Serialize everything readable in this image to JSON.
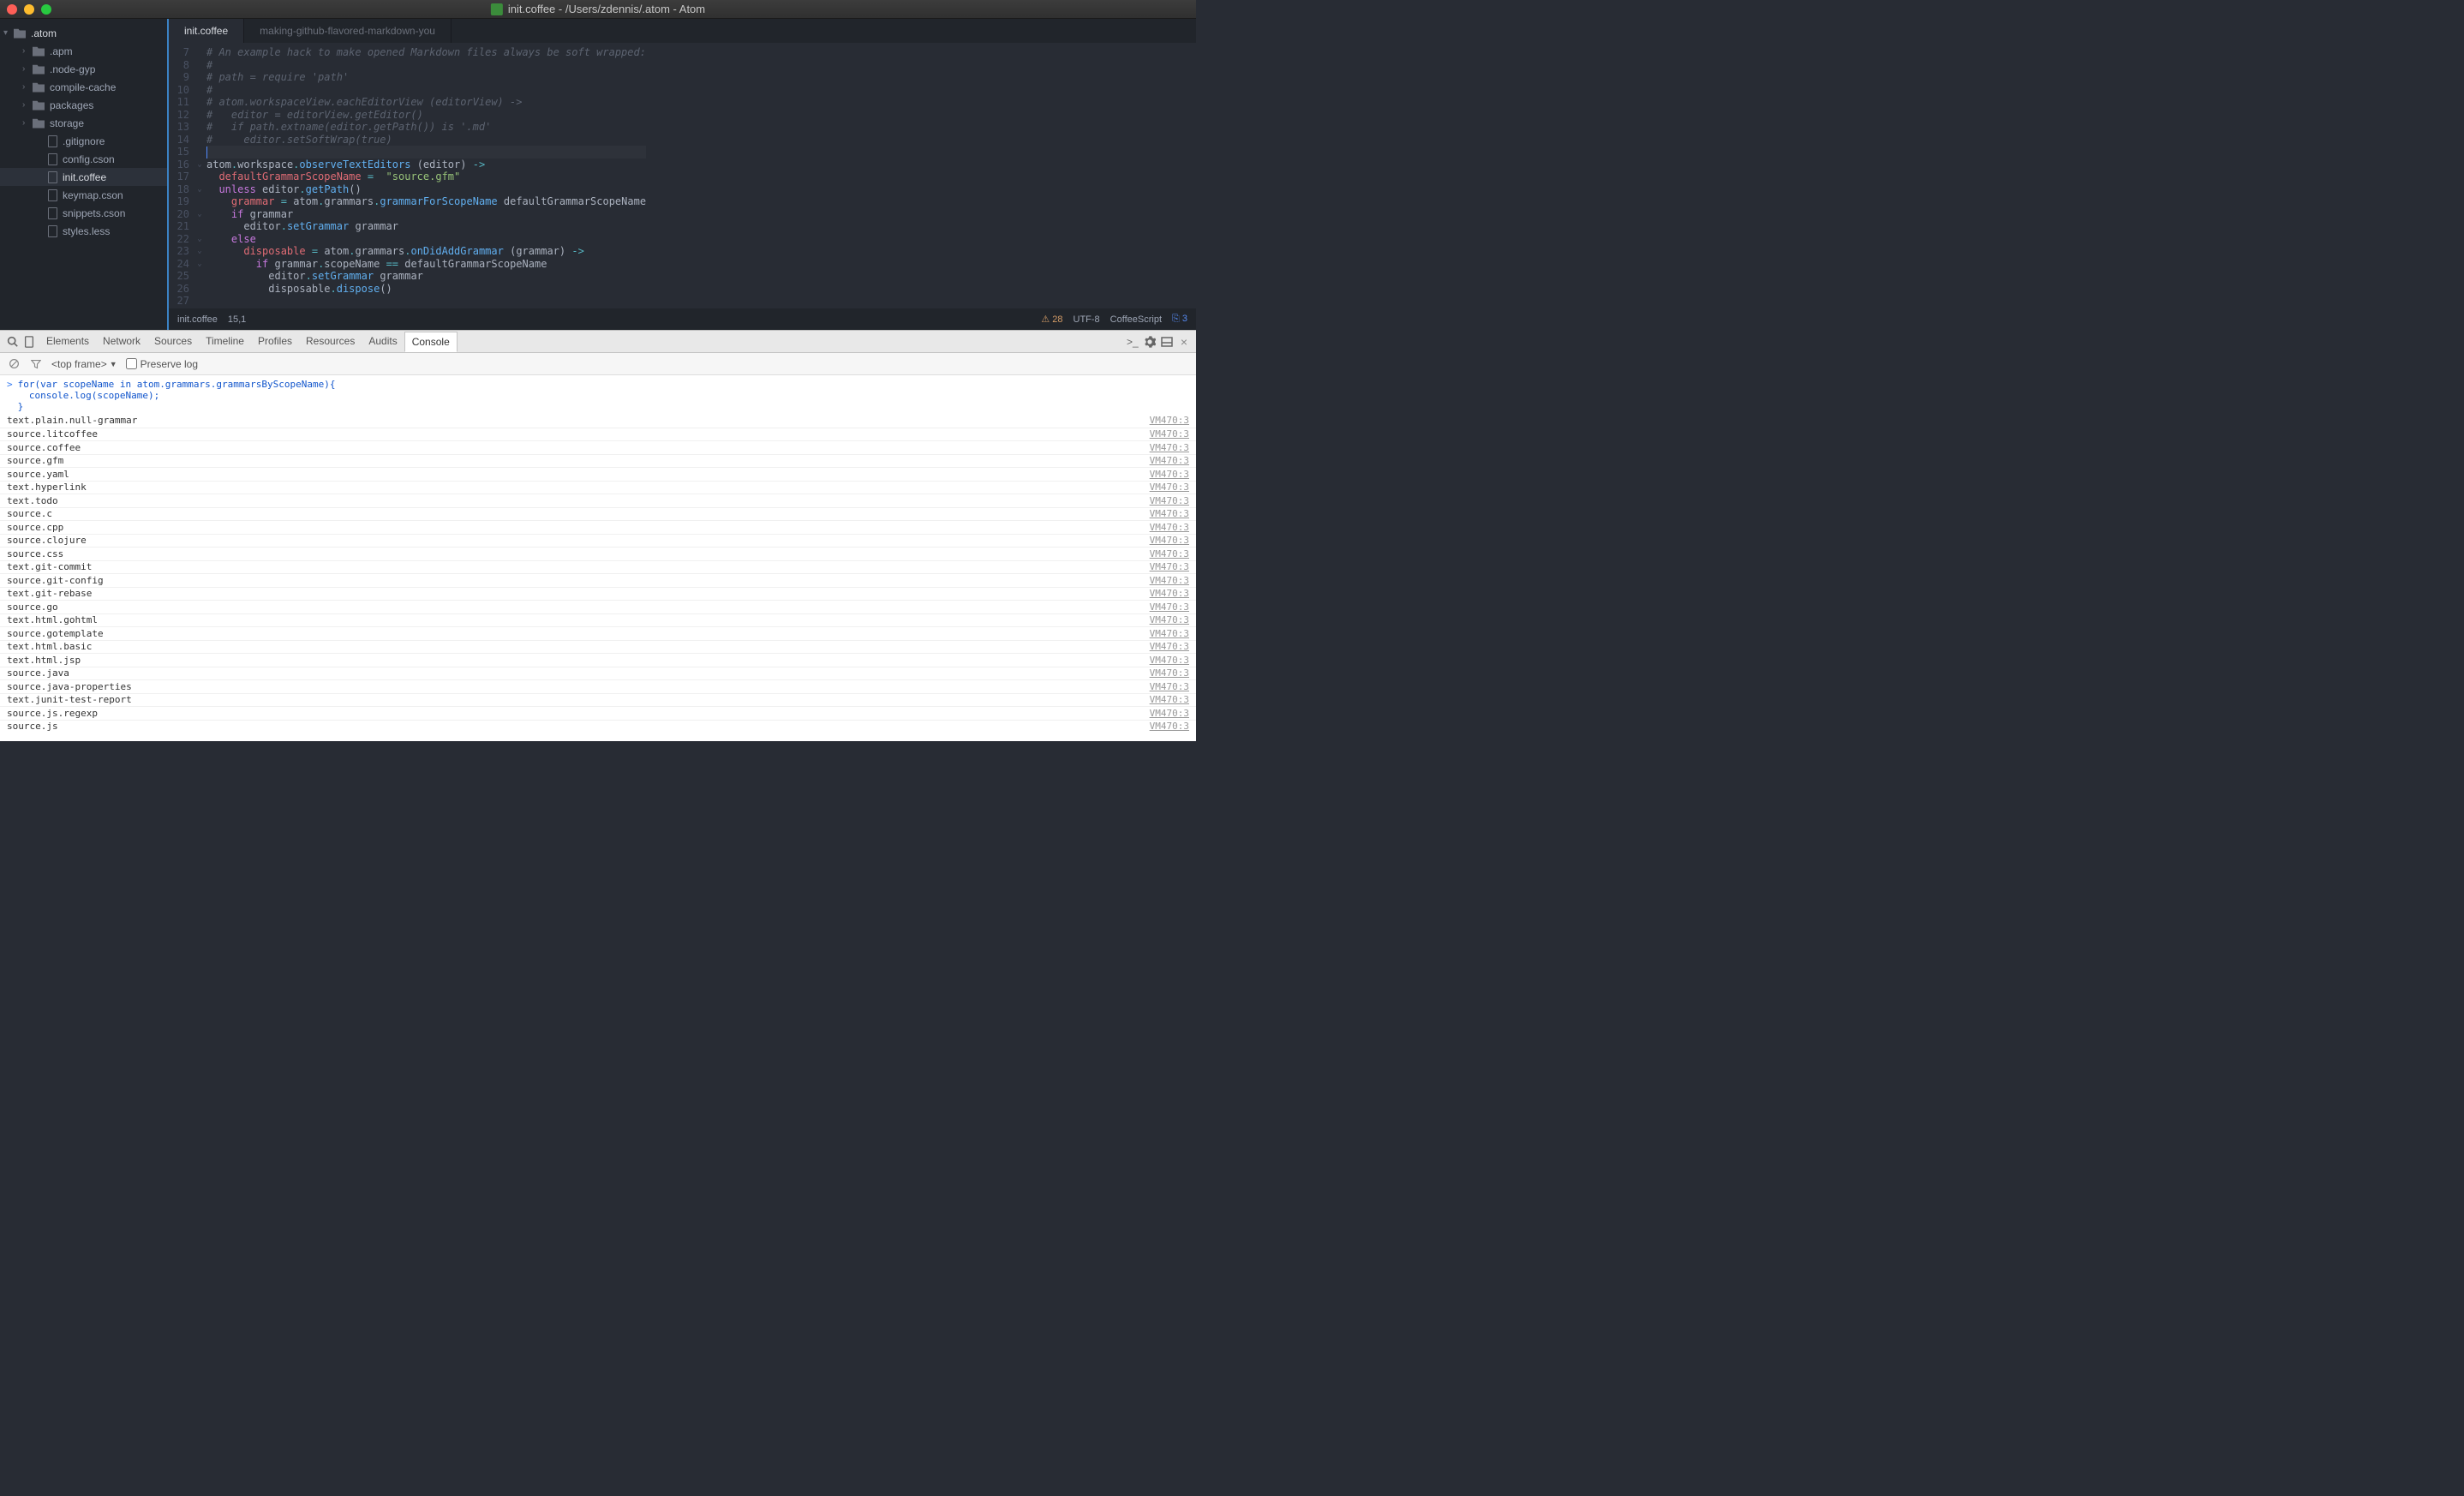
{
  "window": {
    "title": "init.coffee - /Users/zdennis/.atom - Atom"
  },
  "tree": {
    "project": ".atom",
    "items": [
      {
        "kind": "folder",
        "label": ".apm",
        "level": 1,
        "expandable": true
      },
      {
        "kind": "folder",
        "label": ".node-gyp",
        "level": 1,
        "expandable": true
      },
      {
        "kind": "folder",
        "label": "compile-cache",
        "level": 1,
        "expandable": true
      },
      {
        "kind": "folder",
        "label": "packages",
        "level": 1,
        "expandable": true
      },
      {
        "kind": "folder",
        "label": "storage",
        "level": 1,
        "expandable": true
      },
      {
        "kind": "file",
        "label": ".gitignore",
        "level": 2
      },
      {
        "kind": "file",
        "label": "config.cson",
        "level": 2
      },
      {
        "kind": "file",
        "label": "init.coffee",
        "level": 2,
        "selected": true
      },
      {
        "kind": "file",
        "label": "keymap.cson",
        "level": 2
      },
      {
        "kind": "file",
        "label": "snippets.cson",
        "level": 2
      },
      {
        "kind": "file",
        "label": "styles.less",
        "level": 2
      }
    ]
  },
  "tabs": [
    {
      "label": "init.coffee",
      "active": true
    },
    {
      "label": "making-github-flavored-markdown-you",
      "active": false
    }
  ],
  "editor": {
    "first_line_no": 7,
    "lines": [
      {
        "t": "comment",
        "text": "# An example hack to make opened Markdown files always be soft wrapped:"
      },
      {
        "t": "comment",
        "text": "#"
      },
      {
        "t": "comment",
        "text": "# path = require 'path'"
      },
      {
        "t": "comment",
        "text": "#"
      },
      {
        "t": "comment",
        "text": "# atom.workspaceView.eachEditorView (editorView) ->"
      },
      {
        "t": "comment",
        "text": "#   editor = editorView.getEditor()"
      },
      {
        "t": "comment",
        "text": "#   if path.extname(editor.getPath()) is '.md'"
      },
      {
        "t": "comment",
        "text": "#     editor.setSoftWrap(true)"
      },
      {
        "t": "cursor",
        "text": ""
      },
      {
        "t": "code",
        "fold": true,
        "html": "<span class='c-plain'>atom</span><span class='c-op'>.</span><span class='c-plain'>workspace</span><span class='c-op'>.</span><span class='c-fn'>observeTextEditors</span> <span class='c-plain'>(editor)</span> <span class='c-op'>-&gt;</span>"
      },
      {
        "t": "code",
        "html": "  <span class='c-prop'>defaultGrammarScopeName</span> <span class='c-op'>=</span>  <span class='c-str'>\"source.gfm\"</span>"
      },
      {
        "t": "code",
        "fold": true,
        "html": "  <span class='c-kw'>unless</span> <span class='c-plain'>editor</span><span class='c-op'>.</span><span class='c-fn'>getPath</span><span class='c-plain'>()</span>"
      },
      {
        "t": "code",
        "html": "    <span class='c-prop'>grammar</span> <span class='c-op'>=</span> <span class='c-plain'>atom</span><span class='c-op'>.</span><span class='c-plain'>grammars</span><span class='c-op'>.</span><span class='c-fn'>grammarForScopeName</span> <span class='c-plain'>defaultGrammarScopeName</span>"
      },
      {
        "t": "code",
        "fold": true,
        "html": "    <span class='c-kw'>if</span> <span class='c-plain'>grammar</span>"
      },
      {
        "t": "code",
        "html": "      <span class='c-plain'>editor</span><span class='c-op'>.</span><span class='c-fn'>setGrammar</span> <span class='c-plain'>grammar</span>"
      },
      {
        "t": "code",
        "fold": true,
        "html": "    <span class='c-kw'>else</span>"
      },
      {
        "t": "code",
        "fold": true,
        "html": "      <span class='c-prop'>disposable</span> <span class='c-op'>=</span> <span class='c-plain'>atom</span><span class='c-op'>.</span><span class='c-plain'>grammars</span><span class='c-op'>.</span><span class='c-fn'>onDidAddGrammar</span> <span class='c-plain'>(grammar)</span> <span class='c-op'>-&gt;</span>"
      },
      {
        "t": "code",
        "fold": true,
        "html": "        <span class='c-kw'>if</span> <span class='c-plain'>grammar</span><span class='c-op'>.</span><span class='c-plain'>scopeName</span> <span class='c-op'>==</span> <span class='c-plain'>defaultGrammarScopeName</span>"
      },
      {
        "t": "code",
        "html": "          <span class='c-plain'>editor</span><span class='c-op'>.</span><span class='c-fn'>setGrammar</span> <span class='c-plain'>grammar</span>"
      },
      {
        "t": "code",
        "html": "          <span class='c-plain'>disposable</span><span class='c-op'>.</span><span class='c-fn'>dispose</span><span class='c-plain'>()</span>"
      },
      {
        "t": "code",
        "html": ""
      }
    ]
  },
  "status": {
    "file": "init.coffee",
    "cursor_pos": "15,1",
    "warnings": "28",
    "encoding": "UTF-8",
    "grammar": "CoffeeScript",
    "git": "3"
  },
  "devtools": {
    "tabs": [
      "Elements",
      "Network",
      "Sources",
      "Timeline",
      "Profiles",
      "Resources",
      "Audits",
      "Console"
    ],
    "active_tab": "Console",
    "frame_selector": "<top frame>",
    "preserve_log_label": "Preserve log",
    "input": "for(var scopeName in atom.grammars.grammarsByScopeName){\n  console.log(scopeName);\n}",
    "source_ref": "VM470:3",
    "logs": [
      "text.plain.null-grammar",
      "source.litcoffee",
      "source.coffee",
      "source.gfm",
      "source.yaml",
      "text.hyperlink",
      "text.todo",
      "source.c",
      "source.cpp",
      "source.clojure",
      "source.css",
      "text.git-commit",
      "source.git-config",
      "text.git-rebase",
      "source.go",
      "text.html.gohtml",
      "source.gotemplate",
      "text.html.basic",
      "text.html.jsp",
      "source.java",
      "source.java-properties",
      "text.junit-test-report",
      "source.js.regexp",
      "source.js"
    ]
  }
}
